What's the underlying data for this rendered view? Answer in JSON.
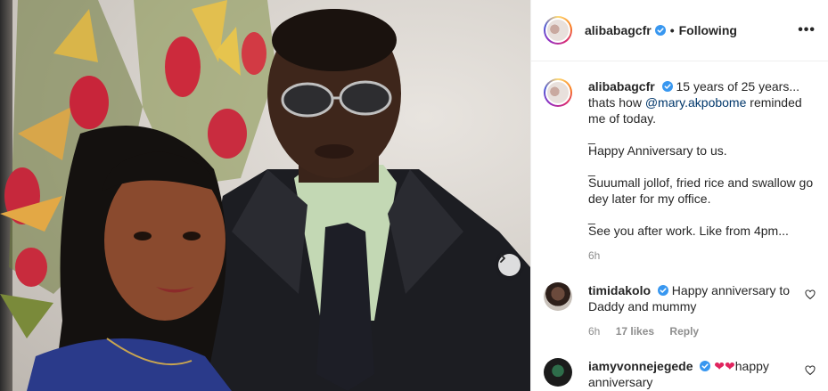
{
  "post": {
    "username": "alibabagcfr",
    "following_label": "Following",
    "separator": "•",
    "more_label": "•••"
  },
  "caption": {
    "username": "alibabagcfr",
    "line1_pre": "15 years of 25 years... thats how ",
    "mention": "@mary.akpobome",
    "line1_post": " reminded me of today.",
    "sep1": "_",
    "line2": "Happy Anniversary to us.",
    "sep2": "_",
    "line3": "Suuumall jollof, fried rice and swallow go dey later for my office.",
    "sep3": "_",
    "line4": "See you after work. Like from 4pm...",
    "time": "6h"
  },
  "comments": [
    {
      "username": "timidakolo",
      "text": "Happy anniversary to Daddy and mummy",
      "time": "6h",
      "likes": "17 likes",
      "reply_label": "Reply"
    },
    {
      "username": "iamyvonnejegede",
      "emoji": "❤❤",
      "text": "happy anniversary"
    }
  ],
  "colors": {
    "verified": "#3897f0",
    "mention": "#00376b",
    "muted": "#8e8e8e",
    "heart": "#ed4956"
  },
  "icons": [
    "verified-badge-icon",
    "more-options-icon",
    "chevron-right-icon",
    "heart-outline-icon"
  ]
}
